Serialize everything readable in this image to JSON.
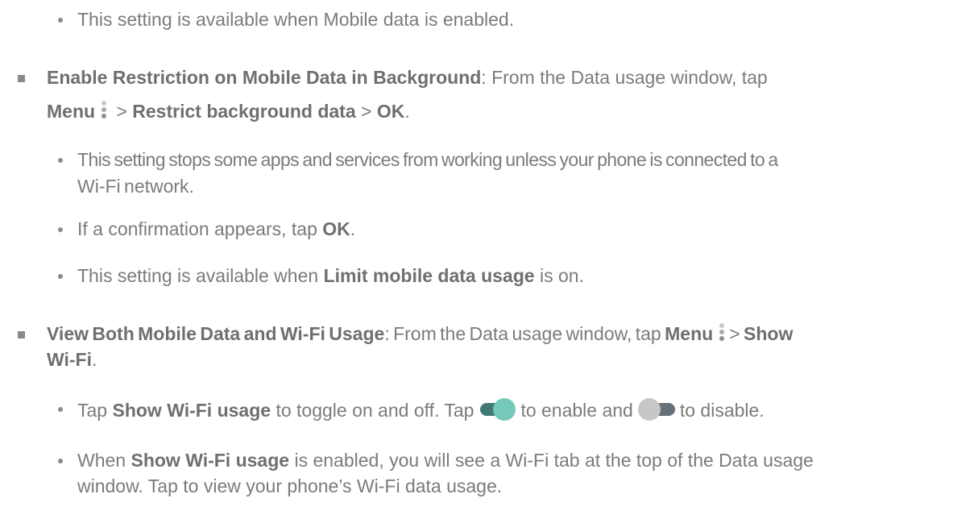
{
  "items": {
    "mobile_note": "This setting is available when Mobile data is enabled.",
    "restrict": {
      "title": "Enable Restriction on Mobile Data in Background",
      "sep": ": From the Data usage window, tap",
      "menu": "Menu",
      "gt1": " > ",
      "restrict_label": "Restrict background data",
      "gt2": " > ",
      "ok": "OK",
      "period": ".",
      "sub1_line1": "This setting stops some apps and services from working unless your phone is connected to a",
      "sub1_line2": "Wi-Fi network.",
      "sub2_pre": "If a confirmation appears, tap ",
      "sub2_ok": "OK",
      "sub2_post": ".",
      "sub3_pre": "This setting is available when ",
      "sub3_bold": "Limit mobile data usage",
      "sub3_post": " is on."
    },
    "view_both": {
      "title": "View Both Mobile Data and Wi-Fi Usage",
      "sep": ": From the Data usage window, tap ",
      "menu": "Menu",
      "gt": "> ",
      "show": "Show",
      "wifi": "Wi-Fi",
      "period": ".",
      "sub1_pre": "Tap ",
      "sub1_bold": "Show Wi-Fi usage",
      "sub1_mid": " to toggle on and off. Tap",
      "sub1_enable": "to enable and",
      "sub1_disable": "to disable.",
      "sub2_pre": "When ",
      "sub2_bold": "Show Wi-Fi usage",
      "sub2_post": " is enabled, you will see a Wi-Fi tab at the top of the Data usage",
      "sub2_line2": "window. Tap to view your phone’s Wi-Fi data usage."
    }
  },
  "icons": {
    "menu": "menu-icon",
    "toggle_on": "toggle-on-icon",
    "toggle_off": "toggle-off-icon"
  },
  "colors": {
    "toggle_on_track": "#417875",
    "toggle_on_knob": "#74c9b9",
    "toggle_off_track": "#64707a",
    "toggle_off_knob": "#c7c7c7"
  }
}
